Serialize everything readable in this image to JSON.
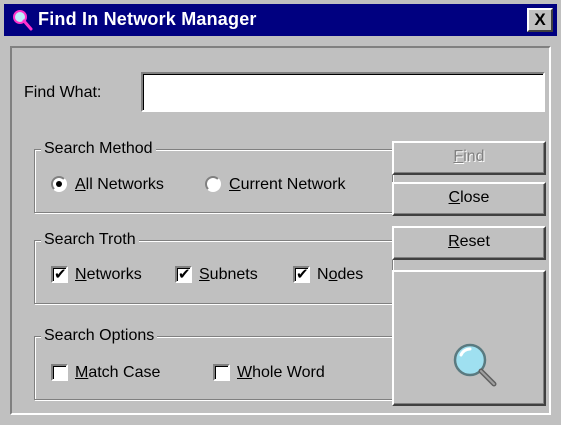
{
  "window": {
    "title": "Find In Network Manager",
    "close_label": "X"
  },
  "find": {
    "label": "Find What:",
    "value": "",
    "placeholder": ""
  },
  "search_method": {
    "legend": "Search Method",
    "options": [
      {
        "mnemonic": "A",
        "rest": "ll Networks",
        "checked": true
      },
      {
        "mnemonic": "C",
        "rest": "urrent Network",
        "checked": false
      }
    ]
  },
  "search_troth": {
    "legend": "Search Troth",
    "options": [
      {
        "mnemonic": "N",
        "rest": "etworks",
        "checked": true
      },
      {
        "mnemonic": "S",
        "rest": "ubnets",
        "checked": true
      },
      {
        "pre": "N",
        "mnemonic": "o",
        "rest": "des",
        "checked": true
      }
    ]
  },
  "search_options": {
    "legend": "Search Options",
    "options": [
      {
        "mnemonic": "M",
        "rest": "atch Case",
        "checked": false
      },
      {
        "mnemonic": "W",
        "rest": "hole Word",
        "checked": false
      }
    ]
  },
  "buttons": {
    "find": {
      "mnemonic": "F",
      "rest": "ind",
      "enabled": false
    },
    "close": {
      "mnemonic": "C",
      "rest": "lose"
    },
    "reset": {
      "mnemonic": "R",
      "rest": "eset"
    }
  },
  "icons": {
    "title": "magnifier-icon",
    "panel": "magnifier-large-icon"
  },
  "colors": {
    "titlebar": "#000080",
    "face": "#c0c0c0",
    "lens": "#9fe0f0"
  }
}
